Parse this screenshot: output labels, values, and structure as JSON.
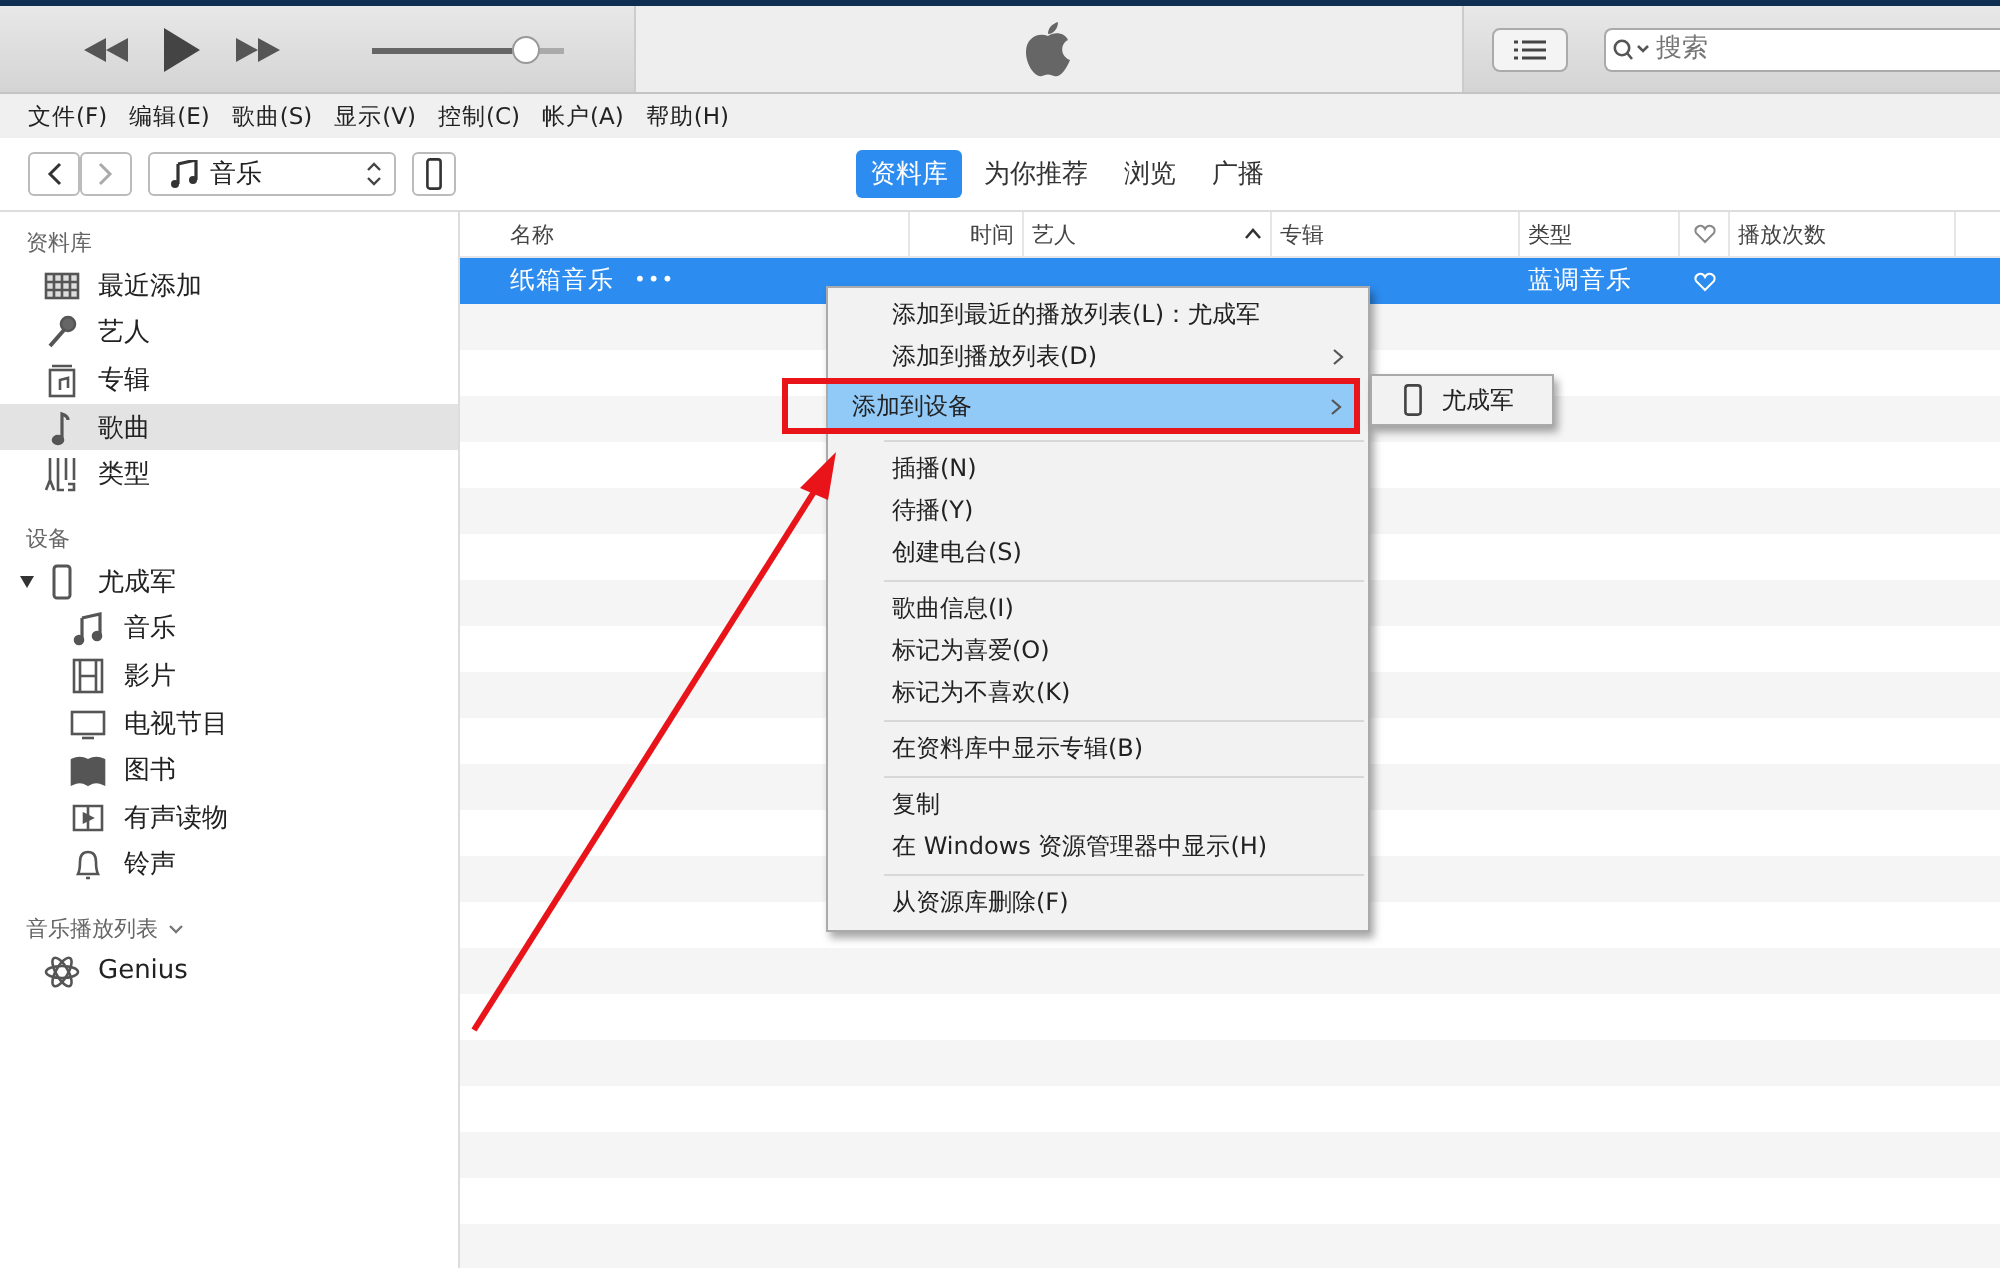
{
  "toolbar": {
    "volume": {
      "level": 0.85
    },
    "search": {
      "placeholder": "搜索"
    }
  },
  "menubar": [
    "文件(F)",
    "编辑(E)",
    "歌曲(S)",
    "显示(V)",
    "控制(C)",
    "帐户(A)",
    "帮助(H)"
  ],
  "nav": {
    "source": "音乐",
    "tabs": [
      {
        "label": "资料库",
        "selected": true
      },
      {
        "label": "为你推荐",
        "selected": false
      },
      {
        "label": "浏览",
        "selected": false
      },
      {
        "label": "广播",
        "selected": false
      }
    ]
  },
  "sidebar": {
    "sections": [
      {
        "title": "资料库",
        "items": [
          {
            "label": "最近添加",
            "kind": "grid",
            "selected": false
          },
          {
            "label": "艺人",
            "kind": "mic",
            "selected": false
          },
          {
            "label": "专辑",
            "kind": "album",
            "selected": false
          },
          {
            "label": "歌曲",
            "kind": "note",
            "selected": true
          },
          {
            "label": "类型",
            "kind": "genre",
            "selected": false
          }
        ]
      },
      {
        "title": "设备",
        "items": [
          {
            "label": "尤成军",
            "kind": "phone",
            "selected": false,
            "expanded": true,
            "children": [
              {
                "label": "音乐",
                "kind": "notes",
                "selected": false
              },
              {
                "label": "影片",
                "kind": "film",
                "selected": false
              },
              {
                "label": "电视节目",
                "kind": "tv",
                "selected": false
              },
              {
                "label": "图书",
                "kind": "book",
                "selected": false
              },
              {
                "label": "有声读物",
                "kind": "audiobook",
                "selected": false
              },
              {
                "label": "铃声",
                "kind": "bell",
                "selected": false
              }
            ]
          }
        ]
      },
      {
        "title": "音乐播放列表",
        "chevron": true,
        "items": [
          {
            "label": "Genius",
            "kind": "atom",
            "selected": false
          }
        ]
      }
    ]
  },
  "table": {
    "columns": [
      {
        "label": "名称",
        "kind": "text"
      },
      {
        "label": "时间",
        "kind": "text"
      },
      {
        "label": "艺人",
        "kind": "text",
        "sorted": true
      },
      {
        "label": "专辑",
        "kind": "text"
      },
      {
        "label": "类型",
        "kind": "text"
      },
      {
        "kind": "heart"
      },
      {
        "label": "播放次数",
        "kind": "text"
      }
    ],
    "rows": [
      {
        "selected": true,
        "more": "•••",
        "cells": [
          "纸箱音乐",
          "",
          "",
          "",
          "蓝调音乐"
        ]
      }
    ]
  },
  "context_menu": {
    "items": [
      {
        "kind": "item",
        "label": "添加到最近的播放列表(L)：尤成军",
        "submenu": false,
        "highlighted": false
      },
      {
        "kind": "item",
        "label": "添加到播放列表(D)",
        "submenu": true,
        "highlighted": false
      },
      {
        "kind": "item",
        "label": "添加到设备",
        "submenu": true,
        "highlighted": true
      },
      {
        "kind": "separator"
      },
      {
        "kind": "item",
        "label": "插播(N)",
        "submenu": false,
        "highlighted": false
      },
      {
        "kind": "item",
        "label": "待播(Y)",
        "submenu": false,
        "highlighted": false
      },
      {
        "kind": "item",
        "label": "创建电台(S)",
        "submenu": false,
        "highlighted": false
      },
      {
        "kind": "separator"
      },
      {
        "kind": "item",
        "label": "歌曲信息(I)",
        "submenu": false,
        "highlighted": false
      },
      {
        "kind": "item",
        "label": "标记为喜爱(O)",
        "submenu": false,
        "highlighted": false
      },
      {
        "kind": "item",
        "label": "标记为不喜欢(K)",
        "submenu": false,
        "highlighted": false
      },
      {
        "kind": "separator"
      },
      {
        "kind": "item",
        "label": "在资料库中显示专辑(B)",
        "submenu": false,
        "highlighted": false
      },
      {
        "kind": "separator"
      },
      {
        "kind": "item",
        "label": "复制",
        "submenu": false,
        "highlighted": false
      },
      {
        "kind": "item",
        "label": "在 Windows 资源管理器中显示(H)",
        "submenu": false,
        "highlighted": false
      },
      {
        "kind": "separator"
      },
      {
        "kind": "item",
        "label": "从资源库删除(F)",
        "submenu": false,
        "highlighted": false
      }
    ],
    "submenu": {
      "items": [
        {
          "label": "尤成军",
          "kind": "phone"
        }
      ]
    }
  }
}
